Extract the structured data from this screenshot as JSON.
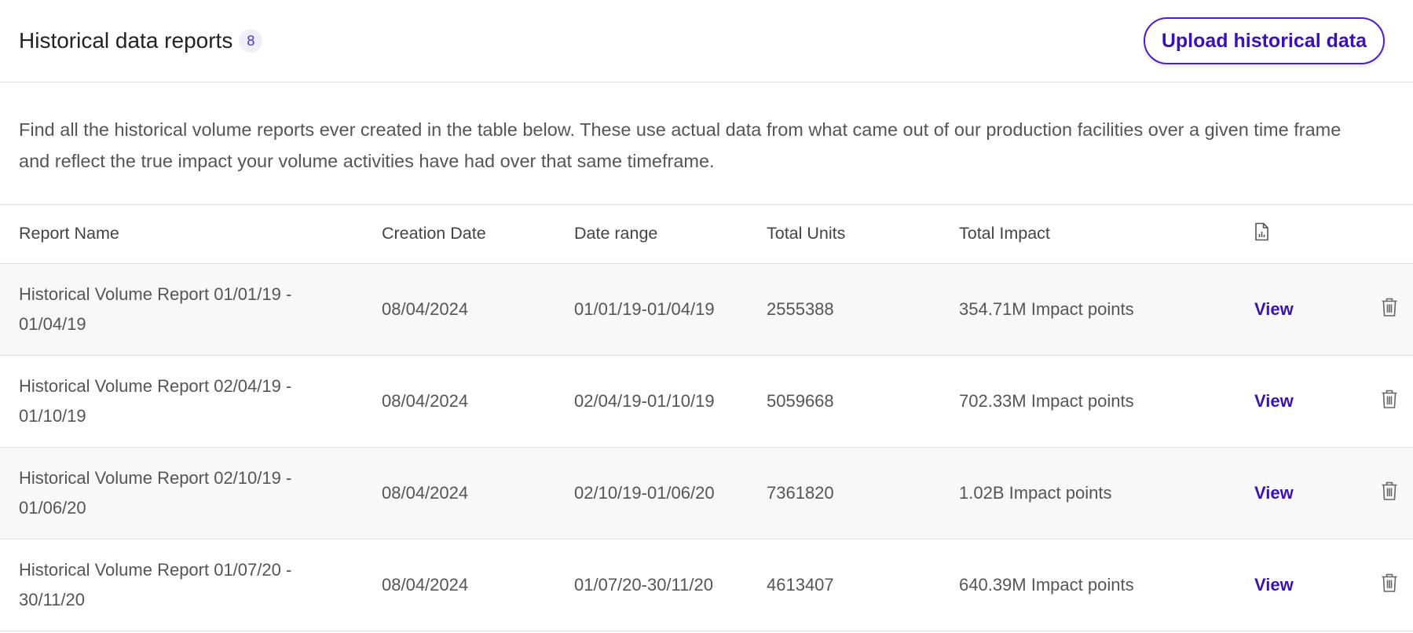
{
  "header": {
    "title": "Historical data reports",
    "count": "8",
    "upload_label": "Upload historical data"
  },
  "description": "Find all the historical volume reports ever created in the table below. These use actual data from what came out of our production facilities over a given time frame and reflect the true impact your volume activities have had over that same timeframe.",
  "table": {
    "headers": [
      "Report Name",
      "Creation Date",
      "Date range",
      "Total Units",
      "Total Impact"
    ],
    "report_icon": "file-chart-icon",
    "view_label": "View",
    "delete_icon": "trash-icon",
    "rows": [
      {
        "name": "Historical Volume Report 01/01/19 - 01/04/19",
        "created": "08/04/2024",
        "range": "01/01/19-01/04/19",
        "units": "2555388",
        "impact": "354.71M Impact points"
      },
      {
        "name": "Historical Volume Report 02/04/19 - 01/10/19",
        "created": "08/04/2024",
        "range": "02/04/19-01/10/19",
        "units": "5059668",
        "impact": "702.33M Impact points"
      },
      {
        "name": "Historical Volume Report 02/10/19 - 01/06/20",
        "created": "08/04/2024",
        "range": "02/10/19-01/06/20",
        "units": "7361820",
        "impact": "1.02B Impact points"
      },
      {
        "name": "Historical Volume Report 01/07/20 - 30/11/20",
        "created": "08/04/2024",
        "range": "01/07/20-30/11/20",
        "units": "4613407",
        "impact": "640.39M Impact points"
      }
    ]
  },
  "colors": {
    "accent": "#3c10b5",
    "badge_bg": "#efeefb",
    "row_alt": "#f8f8f8"
  }
}
